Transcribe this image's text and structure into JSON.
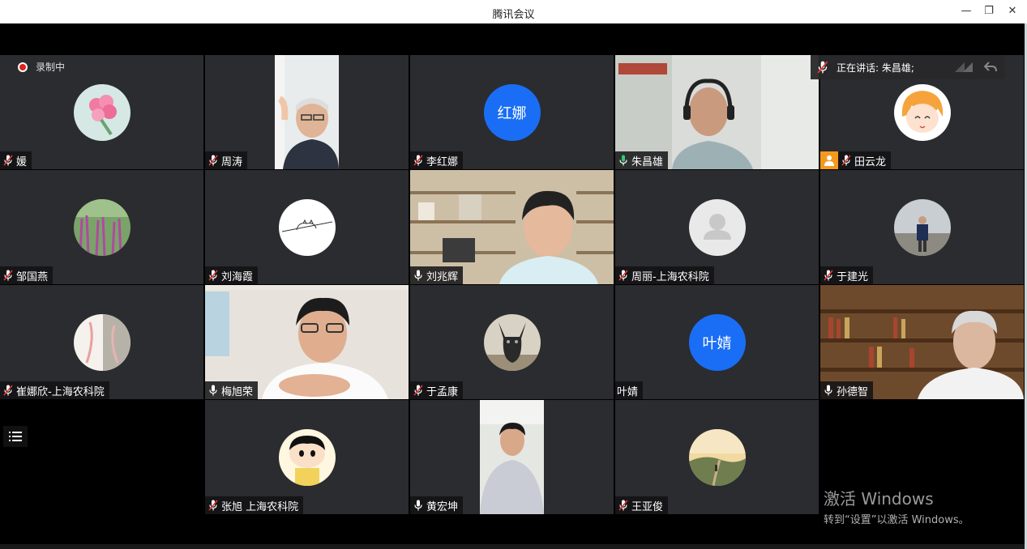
{
  "window": {
    "title": "腾讯会议",
    "minimize_glyph": "—",
    "restore_glyph": "❐",
    "close_glyph": "✕"
  },
  "recording": {
    "label": "录制中"
  },
  "speaker_bar": {
    "text": "正在讲话: 朱昌雄;"
  },
  "participants": [
    {
      "name": "媛",
      "muted": true
    },
    {
      "name": "周涛",
      "muted": true
    },
    {
      "name": "李红娜",
      "muted": true,
      "avatar_text": "红娜"
    },
    {
      "name": "朱昌雄",
      "muted": false,
      "speaking": true
    },
    {
      "name": "田云龙",
      "muted": true
    },
    {
      "name": "邹国燕",
      "muted": true
    },
    {
      "name": "刘海霞",
      "muted": true
    },
    {
      "name": "刘兆辉",
      "muted": false
    },
    {
      "name": "周丽-上海农科院",
      "muted": true
    },
    {
      "name": "于建光",
      "muted": true
    },
    {
      "name": "崔娜欣-上海农科院",
      "muted": true
    },
    {
      "name": "梅旭荣",
      "muted": false
    },
    {
      "name": "于孟康",
      "muted": true
    },
    {
      "name": "叶婧",
      "avatar_text": "叶婧"
    },
    {
      "name": "孙德智",
      "muted": false
    },
    {
      "name": "张旭 上海农科院",
      "muted": true
    },
    {
      "name": "黄宏坤",
      "muted": false
    },
    {
      "name": "王亚俊",
      "muted": true
    }
  ],
  "watermark": {
    "line1": "激活 Windows",
    "line2": "转到“设置”以激活 Windows。"
  },
  "colors": {
    "avatar_blue": "#1a6ef5",
    "tile_bg": "#2b2c30",
    "speaking_border": "#1aa36b"
  }
}
